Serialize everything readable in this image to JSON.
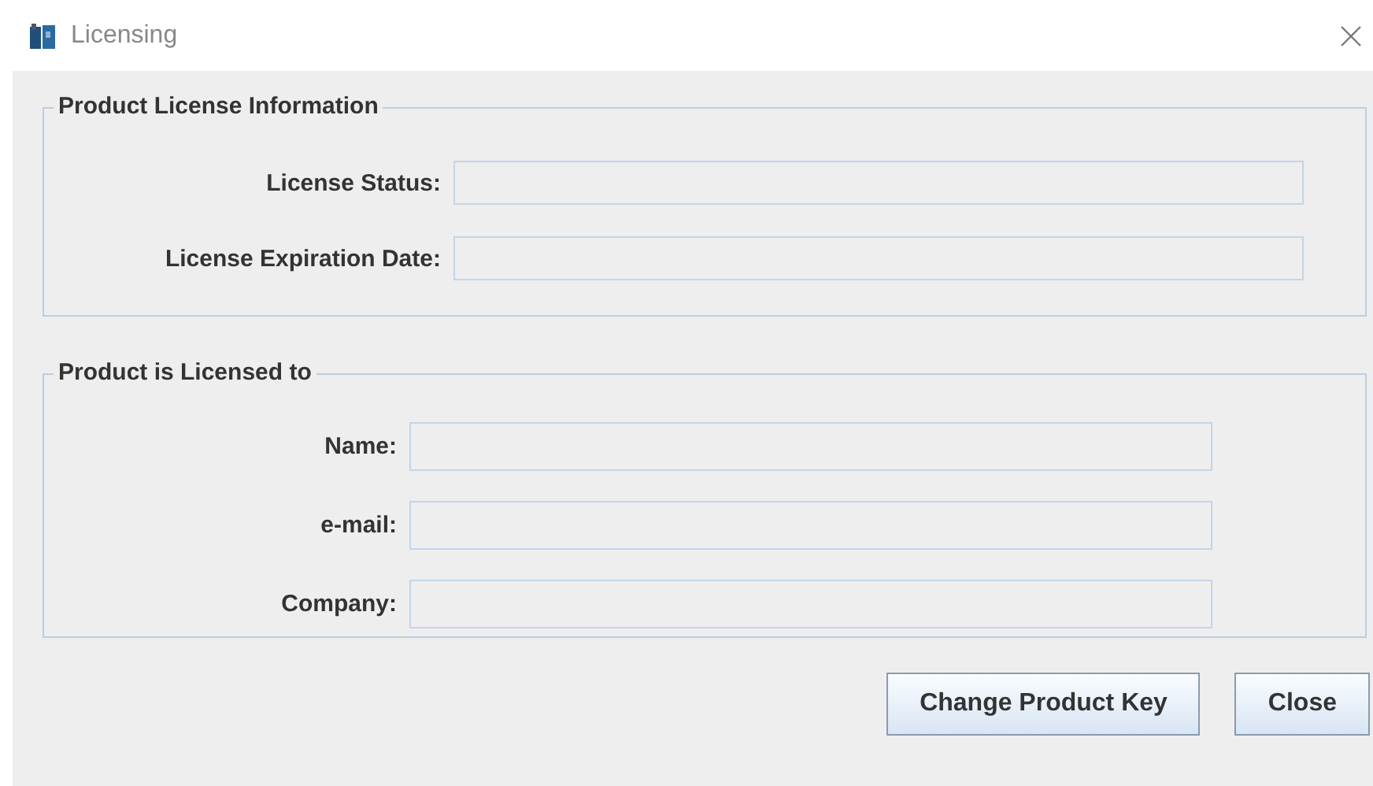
{
  "window": {
    "title": "Licensing"
  },
  "groups": [
    {
      "title": "Product License Information",
      "fields": [
        {
          "label": "License Status:"
        },
        {
          "label": "License Expiration Date:"
        }
      ]
    },
    {
      "title": "Product is Licensed to",
      "fields": [
        {
          "label": "Name:"
        },
        {
          "label": "e-mail:"
        },
        {
          "label": "Company:"
        }
      ]
    }
  ],
  "buttons": [
    {
      "label": "Change Product Key"
    },
    {
      "label": "Close"
    }
  ]
}
